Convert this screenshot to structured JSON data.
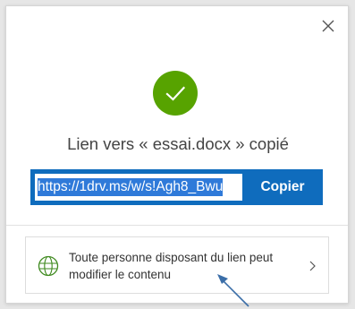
{
  "dialog": {
    "title": "Lien vers « essai.docx » copié",
    "link_value": "https://1drv.ms/w/s!Agh8_Bwu",
    "copy_label": "Copier",
    "permission_text": "Toute personne disposant du lien peut modifier le contenu"
  },
  "icons": {
    "close": "close-icon",
    "success": "checkmark-icon",
    "permission": "globe-icon",
    "chevron": "chevron-right-icon"
  },
  "colors": {
    "success_green": "#57a300",
    "accent_blue": "#0f6cbd",
    "selection_blue": "#2f7ad9",
    "annotation_arrow": "#3b6ea8"
  }
}
